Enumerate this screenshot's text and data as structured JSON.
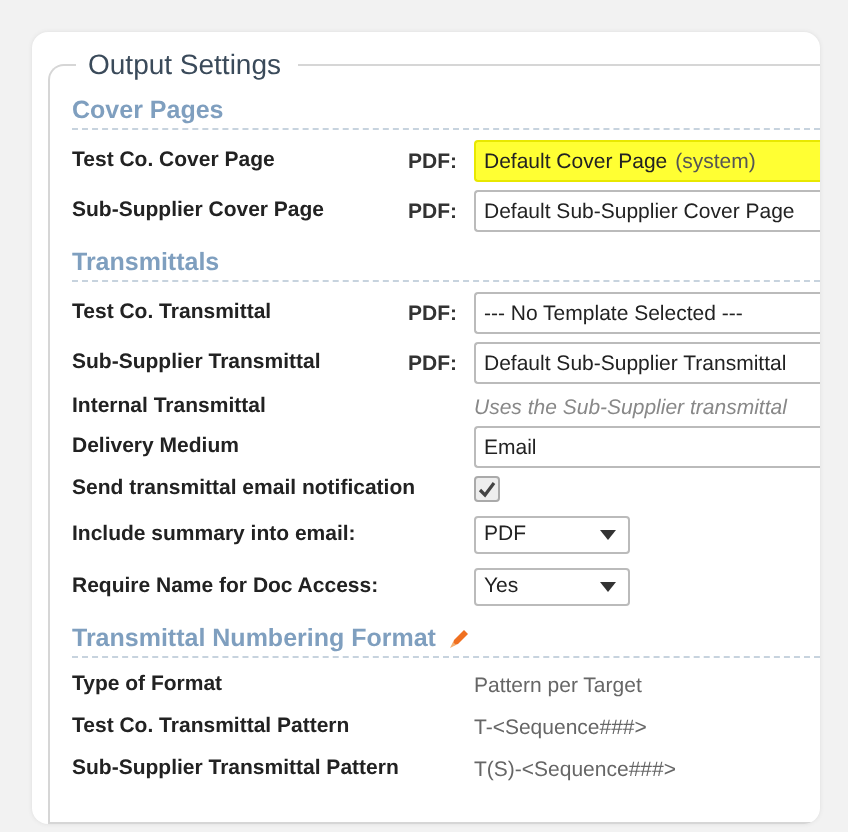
{
  "legend": "Output Settings",
  "sections": [
    {
      "heading": "Cover Pages",
      "editable": false,
      "rows": [
        {
          "label": "Test Co. Cover Page",
          "kind": "select",
          "prefix": "PDF:",
          "value": "Default Cover Page",
          "suffix": "(system)",
          "highlighted": true
        },
        {
          "label": "Sub-Supplier Cover Page",
          "kind": "select",
          "prefix": "PDF:",
          "value": "Default Sub-Supplier Cover Page",
          "highlighted": false
        }
      ]
    },
    {
      "heading": "Transmittals",
      "editable": false,
      "rows": [
        {
          "label": "Test Co. Transmittal",
          "kind": "select",
          "prefix": "PDF:",
          "value": "--- No Template Selected ---",
          "highlighted": false
        },
        {
          "label": "Sub-Supplier Transmittal",
          "kind": "select",
          "prefix": "PDF:",
          "value": "Default Sub-Supplier Transmittal",
          "highlighted": false
        },
        {
          "label": "Internal Transmittal",
          "kind": "note",
          "value": "Uses the Sub-Supplier transmittal"
        },
        {
          "label": "Delivery Medium",
          "kind": "wide",
          "value": "Email"
        },
        {
          "label": "Send transmittal email notification",
          "kind": "checkbox",
          "checked": true
        },
        {
          "label": "Include summary into email:",
          "kind": "dropdown",
          "value": "PDF"
        },
        {
          "label": "Require Name for Doc Access:",
          "kind": "dropdown",
          "value": "Yes"
        }
      ]
    },
    {
      "heading": "Transmittal Numbering Format",
      "editable": true,
      "rows": [
        {
          "label": "Type of Format",
          "kind": "text",
          "value": "Pattern per Target"
        },
        {
          "label": "Test Co. Transmittal Pattern",
          "kind": "text",
          "value": "T-<Sequence###>"
        },
        {
          "label": "Sub-Supplier Transmittal Pattern",
          "kind": "text",
          "value": "T(S)-<Sequence###>"
        }
      ]
    }
  ]
}
